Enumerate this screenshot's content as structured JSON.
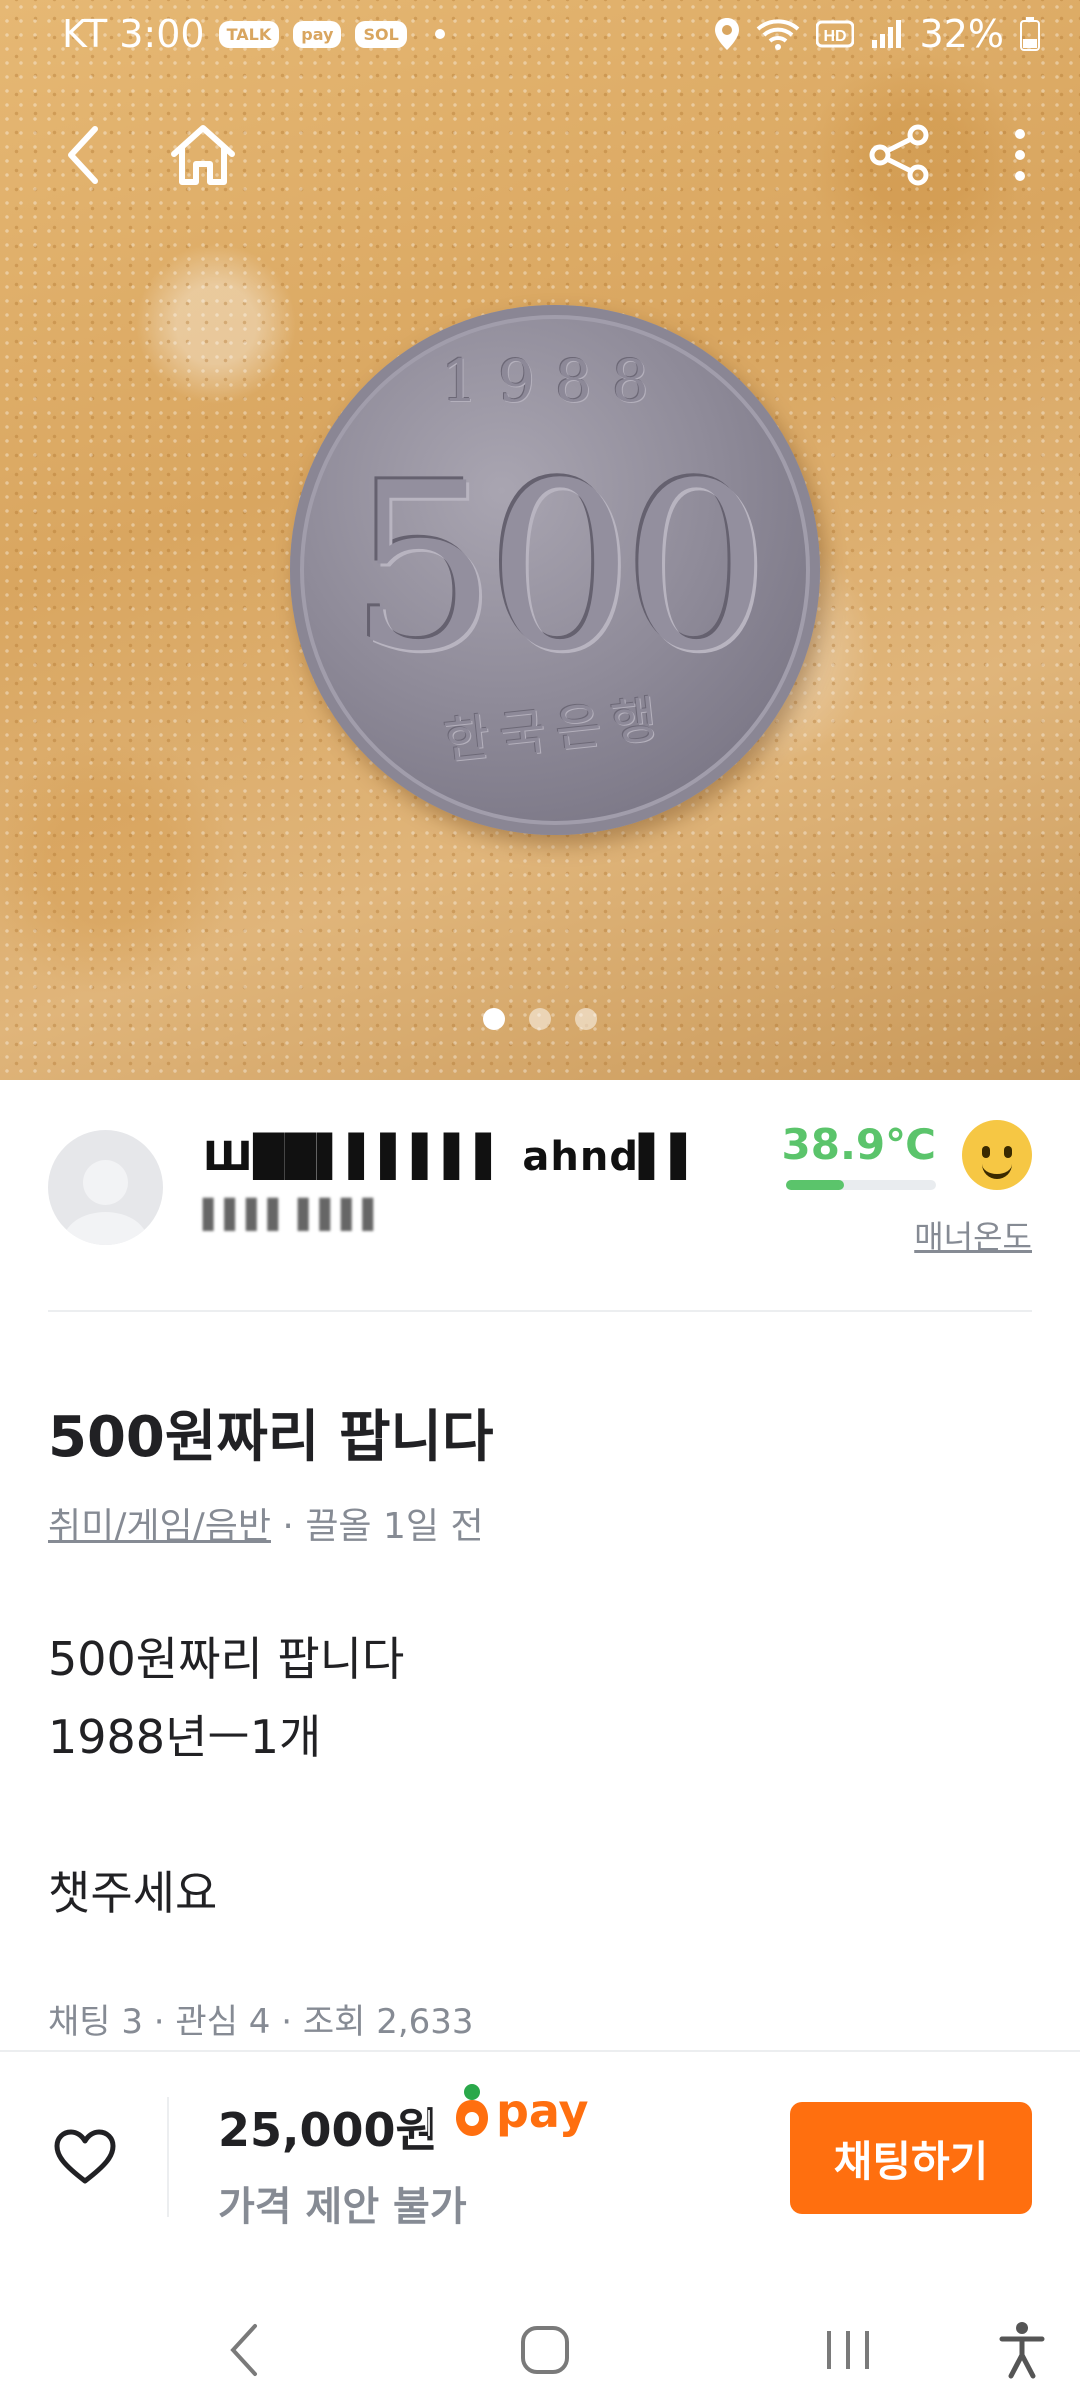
{
  "status_bar": {
    "carrier_time": "KT 3:00",
    "badges": [
      "TALK",
      "pay",
      "SOL"
    ],
    "battery": "32%",
    "icons": [
      "location-icon",
      "wifi-icon",
      "hd-icon",
      "signal-icon",
      "battery-icon"
    ]
  },
  "top_nav": {
    "icons": [
      "back-icon",
      "home-icon",
      "share-icon",
      "more-icon"
    ]
  },
  "photo": {
    "coin_year": "1988",
    "coin_value": "500",
    "coin_bank": "한국은행",
    "page_count": 3,
    "active_page": 1
  },
  "seller": {
    "name": "Ш██▌▌▌▌▌▌ ahnd▌▌",
    "location": "▌▌▌▌ ▌▌▌▌",
    "temperature": "38.9℃",
    "temperature_level": 0.389,
    "manner_label": "매너온도"
  },
  "post": {
    "title": "500원짜리 팝니다",
    "category": "취미/게임/음반",
    "meta_suffix": " · 끌올 1일 전",
    "description": [
      "500원짜리 팝니다",
      "1988년ㅡ1개",
      "",
      "챗주세요"
    ],
    "stats": "채팅 3 · 관심 4 · 조회 2,633"
  },
  "bottom_bar": {
    "price": "25,000원",
    "pay_label": "pay",
    "negotiation": "가격 제안 불가",
    "chat_button": "채팅하기"
  },
  "colors": {
    "accent": "#ff6f0f",
    "temperature": "#5bc46b",
    "muted": "#868b94"
  }
}
